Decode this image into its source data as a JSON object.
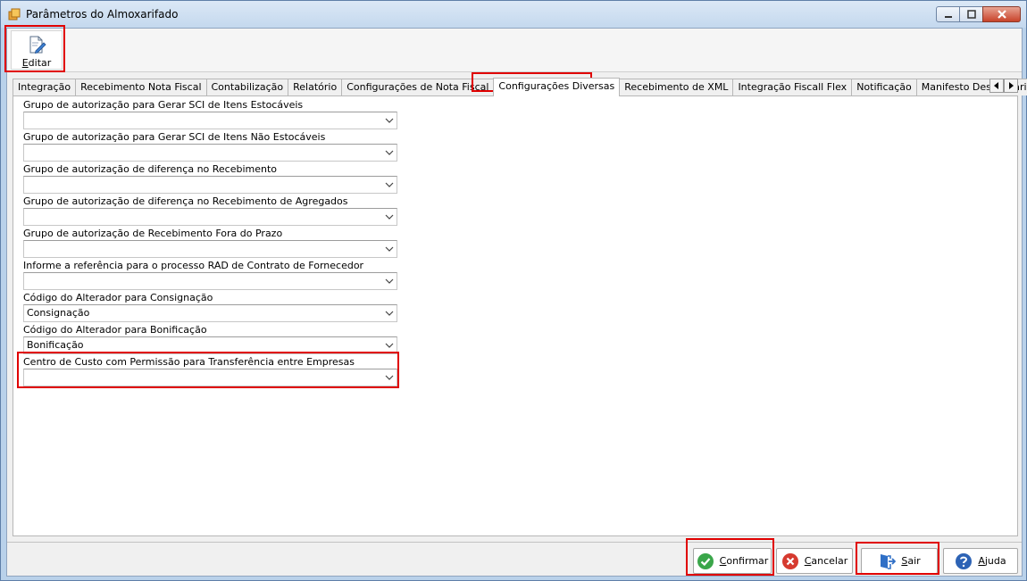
{
  "window": {
    "title": "Parâmetros do Almoxarifado"
  },
  "toolbar": {
    "edit_label": "Editar"
  },
  "tabs": [
    {
      "label": "Integração"
    },
    {
      "label": "Recebimento Nota Fiscal"
    },
    {
      "label": "Contabilização"
    },
    {
      "label": "Relatório"
    },
    {
      "label": "Configurações de Nota Fiscal"
    },
    {
      "label": "Configurações Diversas",
      "active": true
    },
    {
      "label": "Recebimento de XML"
    },
    {
      "label": "Integração Fiscall Flex"
    },
    {
      "label": "Notificação"
    },
    {
      "label": "Manifesto Destinatário"
    }
  ],
  "fields": [
    {
      "label": "Grupo de autorização para Gerar SCI de Itens Estocáveis",
      "value": ""
    },
    {
      "label": "Grupo de autorização para Gerar SCI de Itens Não Estocáveis",
      "value": ""
    },
    {
      "label": "Grupo de autorização de diferença no Recebimento",
      "value": ""
    },
    {
      "label": "Grupo de autorização de diferença no Recebimento de Agregados",
      "value": ""
    },
    {
      "label": "Grupo de autorização de Recebimento Fora do Prazo",
      "value": ""
    },
    {
      "label": "Informe a referência para o processo RAD de Contrato de Fornecedor",
      "value": ""
    },
    {
      "label": "Código do Alterador para Consignação",
      "value": "Consignação"
    },
    {
      "label": "Código do Alterador para Bonificação",
      "value": "Bonificação"
    },
    {
      "label": "Centro de Custo com Permissão para Transferência entre Empresas",
      "value": ""
    }
  ],
  "footer": {
    "confirm": {
      "first": "C",
      "rest": "onfirmar"
    },
    "cancel": {
      "first": "C",
      "rest": "ancelar"
    },
    "exit": {
      "first": "S",
      "rest": "air"
    },
    "help": {
      "first": "A",
      "rest": "juda"
    }
  },
  "colors": {
    "highlight": "#e00000",
    "confirm_icon": "#3aa64a",
    "cancel_icon": "#d63a2f",
    "help_icon": "#2d63b5",
    "exit_icon": "#2f6fc6"
  }
}
